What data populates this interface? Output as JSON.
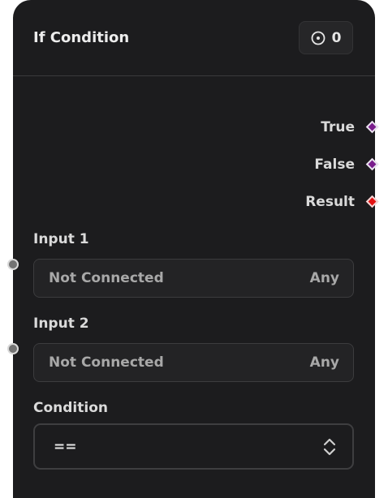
{
  "node": {
    "title": "If Condition",
    "run_count": "0",
    "run_icon": "circle-dot-icon"
  },
  "outputs": [
    {
      "label": "True",
      "port_color": "#7a1d8c"
    },
    {
      "label": "False",
      "port_color": "#7a1d8c"
    },
    {
      "label": "Result",
      "port_color": "#e31212"
    }
  ],
  "inputs": [
    {
      "label": "Input 1",
      "value": "Not Connected",
      "type": "Any"
    },
    {
      "label": "Input 2",
      "value": "Not Connected",
      "type": "Any"
    }
  ],
  "condition": {
    "label": "Condition",
    "selected": "==",
    "icon": "chevron-up-down-icon"
  },
  "colors": {
    "node_bg": "#1c1c1e",
    "text": "#dadada",
    "muted_text": "#a8a8a8"
  }
}
